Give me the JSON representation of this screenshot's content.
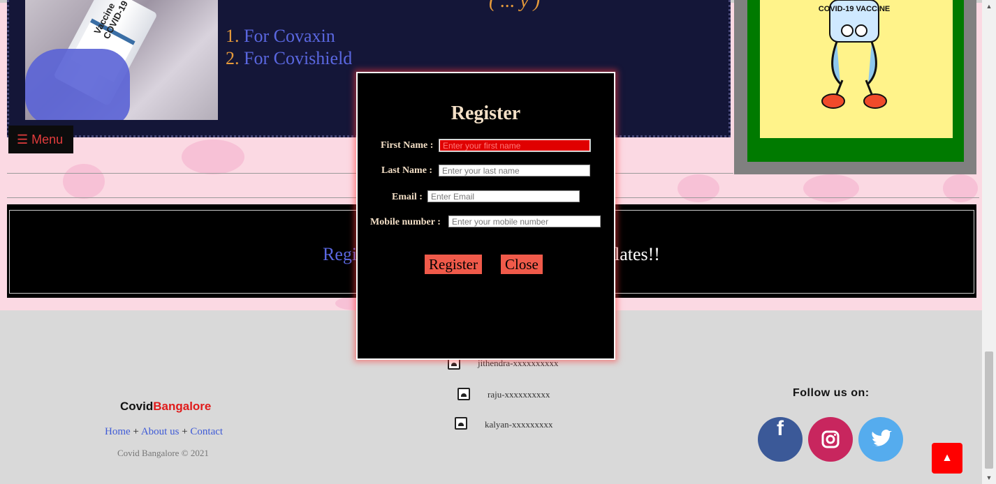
{
  "banner": {
    "heading_fragment": "( ... y )",
    "vial_text": "Vaccine COVID-19",
    "options": [
      {
        "num": "1.",
        "label": "For Covaxin"
      },
      {
        "num": "2.",
        "label": "For Covishield"
      }
    ],
    "menu_label": "☰ Menu",
    "sticker_text": "COVID-19 VACCINE"
  },
  "band": {
    "text_left": "Regi",
    "text_right": "lates!!"
  },
  "modal": {
    "title": "Register",
    "fields": [
      {
        "label": "First Name :",
        "placeholder": "Enter your first name"
      },
      {
        "label": "Last Name :",
        "placeholder": "Enter your last name"
      },
      {
        "label": "Email :",
        "placeholder": "Enter Email"
      },
      {
        "label": "Mobile number :",
        "placeholder": "Enter your mobile number"
      }
    ],
    "register_label": "Register",
    "close_label": "Close"
  },
  "footer": {
    "brand_a": "Covid",
    "brand_b": "Bangalore",
    "links": [
      "Home",
      "About us",
      "Contact"
    ],
    "link_sep": "+",
    "copyright": "Covid Bangalore © 2021",
    "contacts": [
      "jithendra-xxxxxxxxxx",
      "raju-xxxxxxxxxx",
      "kalyan-xxxxxxxxx"
    ],
    "follow_label": "Follow us on:",
    "social": [
      {
        "icon": "facebook-icon",
        "glyph": "f",
        "color": "#3b5998"
      },
      {
        "icon": "instagram-icon",
        "glyph": "◎",
        "color": "#c8265e"
      },
      {
        "icon": "twitter-icon",
        "glyph": "🐦",
        "color": "#55acee"
      }
    ],
    "top_glyph": "▲"
  },
  "colors": {
    "accent_red": "#ff0000",
    "modal_button": "#f05a4a",
    "label": "#f3dfc6"
  }
}
